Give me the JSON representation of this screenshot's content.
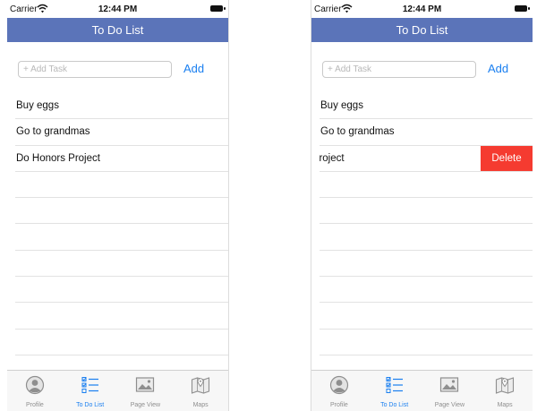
{
  "screens": [
    {
      "status": {
        "carrier": "Carrier",
        "time": "12:44 PM"
      },
      "nav": {
        "title": "To Do List"
      },
      "add": {
        "placeholder": "+ Add Task",
        "button": "Add"
      },
      "tasks": [
        {
          "label": "Buy eggs"
        },
        {
          "label": "Go to grandmas"
        },
        {
          "label": "Do Honors Project"
        }
      ],
      "tabs": [
        {
          "label": "Profile",
          "icon": "profile-icon"
        },
        {
          "label": "To Do List",
          "icon": "checklist-icon",
          "active": true
        },
        {
          "label": "Page View",
          "icon": "image-icon"
        },
        {
          "label": "Maps",
          "icon": "map-icon"
        }
      ]
    },
    {
      "status": {
        "carrier": "Carrier",
        "time": "12:44 PM"
      },
      "nav": {
        "title": "To Do List"
      },
      "add": {
        "placeholder": "+ Add Task",
        "button": "Add"
      },
      "tasks": [
        {
          "label": "Buy eggs"
        },
        {
          "label": "Go to grandmas"
        },
        {
          "label": "rs Project",
          "delete_label": "Delete"
        }
      ],
      "tabs": [
        {
          "label": "Profile",
          "icon": "profile-icon"
        },
        {
          "label": "To Do List",
          "icon": "checklist-icon",
          "active": true
        },
        {
          "label": "Page View",
          "icon": "image-icon"
        },
        {
          "label": "Maps",
          "icon": "map-icon"
        }
      ]
    }
  ],
  "colors": {
    "nav": "#5b74b9",
    "accent": "#1a7ff0",
    "delete": "#f53b30",
    "tab_inactive": "#8e8e8e"
  }
}
